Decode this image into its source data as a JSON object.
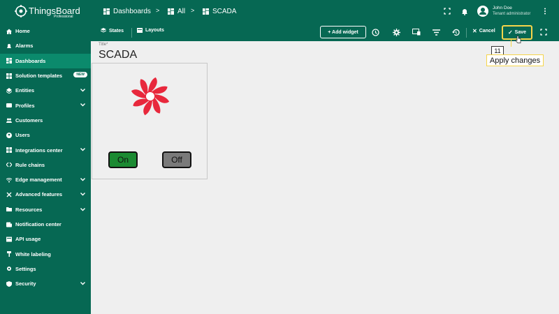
{
  "brand": {
    "name": "ThingsBoard",
    "sub": "Professional"
  },
  "sidebar": {
    "items": [
      {
        "label": "Home",
        "icon": "home-icon",
        "chevron": false
      },
      {
        "label": "Alarms",
        "icon": "alarm-icon",
        "chevron": false
      },
      {
        "label": "Dashboards",
        "icon": "dashboard-icon",
        "chevron": false,
        "active": true
      },
      {
        "label": "Solution templates",
        "icon": "templates-icon",
        "chevron": false,
        "badge": "NEW"
      },
      {
        "label": "Entities",
        "icon": "entities-icon",
        "chevron": true
      },
      {
        "label": "Profiles",
        "icon": "profiles-icon",
        "chevron": true
      },
      {
        "label": "Customers",
        "icon": "customers-icon",
        "chevron": false
      },
      {
        "label": "Users",
        "icon": "users-icon",
        "chevron": false
      },
      {
        "label": "Integrations center",
        "icon": "integrations-icon",
        "chevron": true
      },
      {
        "label": "Rule chains",
        "icon": "rule-chains-icon",
        "chevron": false
      },
      {
        "label": "Edge management",
        "icon": "edge-icon",
        "chevron": true
      },
      {
        "label": "Advanced features",
        "icon": "advanced-icon",
        "chevron": true
      },
      {
        "label": "Resources",
        "icon": "folder-icon",
        "chevron": true
      },
      {
        "label": "Notification center",
        "icon": "notification-icon",
        "chevron": false
      },
      {
        "label": "API usage",
        "icon": "api-icon",
        "chevron": false
      },
      {
        "label": "White labeling",
        "icon": "brush-icon",
        "chevron": false
      },
      {
        "label": "Settings",
        "icon": "gear-icon",
        "chevron": false
      },
      {
        "label": "Security",
        "icon": "shield-icon",
        "chevron": true
      }
    ]
  },
  "header": {
    "breadcrumb": [
      "Dashboards",
      "All",
      "SCADA"
    ],
    "separator": ">",
    "user_name": "John Doe",
    "user_role": "Tenant administrator"
  },
  "toolbar": {
    "states_label": "States",
    "layouts_label": "Layouts",
    "add_widget_label": "+ Add widget",
    "cancel_label": "Cancel",
    "save_label": "Save"
  },
  "dashboard": {
    "title_label": "Title*",
    "title": "SCADA",
    "on_label": "On",
    "off_label": "Off"
  },
  "annotation": {
    "number": "11",
    "text": "Apply changes"
  },
  "colors": {
    "primary": "#066853",
    "active_item": "#0b8a6c",
    "highlight": "#f6d54a",
    "fan_red": "#e8283c",
    "on_green": "#1b8a32",
    "off_gray": "#7a7a7a"
  }
}
